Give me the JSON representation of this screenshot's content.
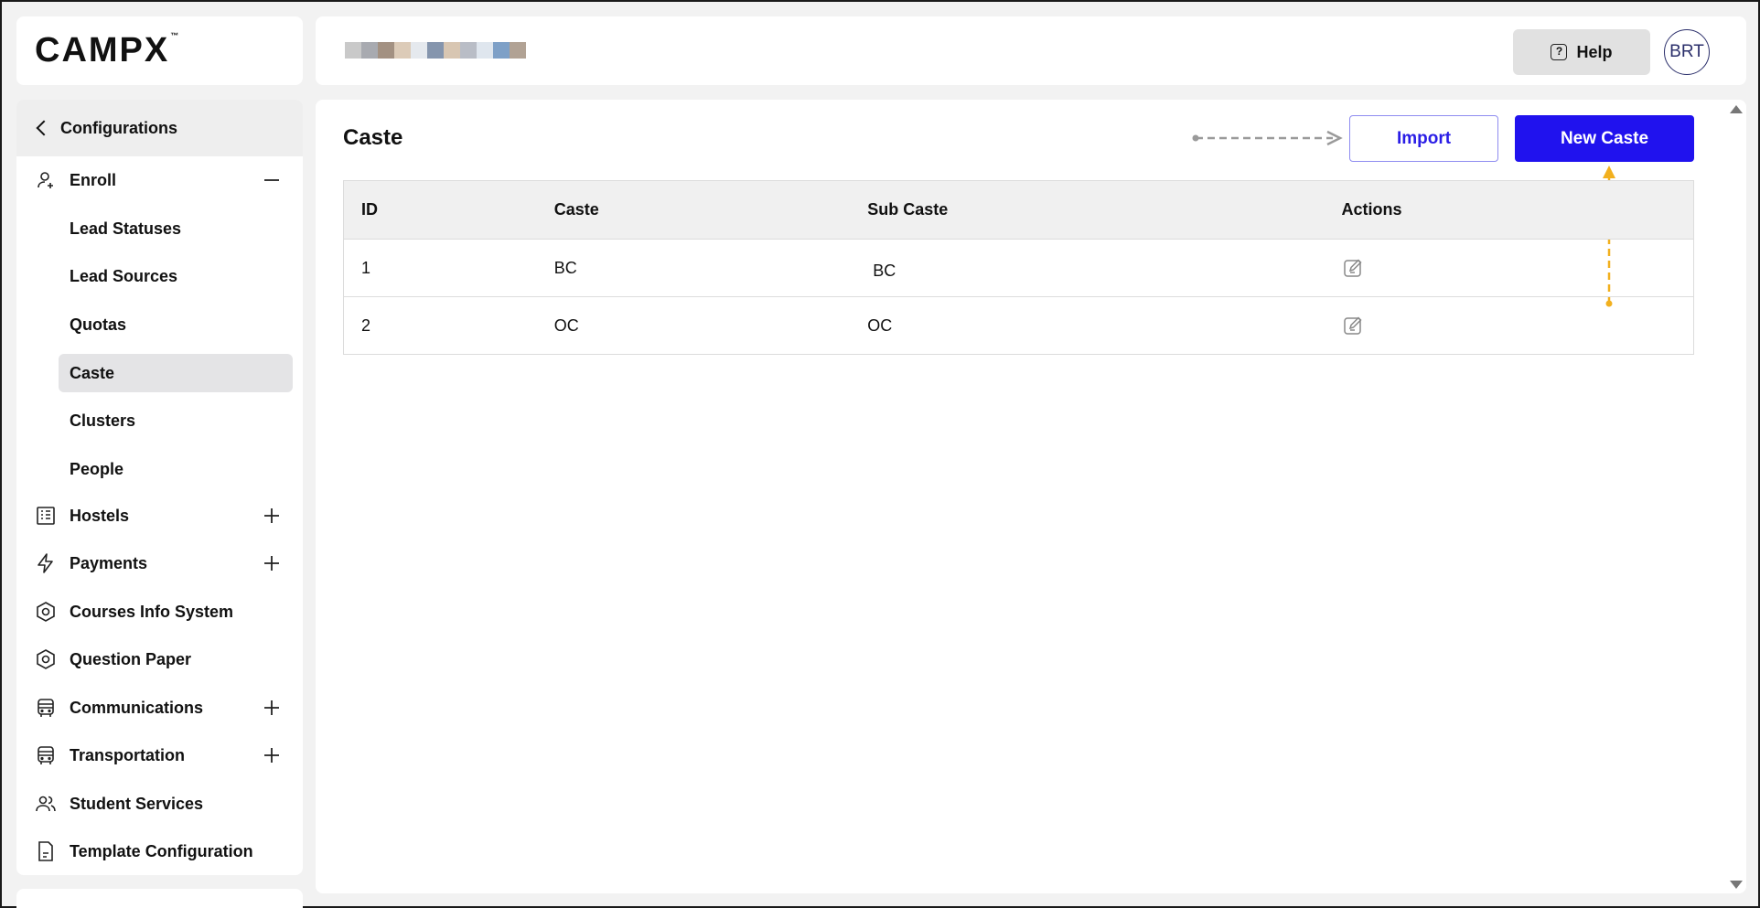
{
  "app": {
    "logo_text": "CAMPX"
  },
  "header": {
    "help_label": "Help",
    "avatar_initials": "BRT"
  },
  "sidebar": {
    "back_label": "Configurations",
    "items": [
      {
        "label": "Enroll",
        "icon": "user-add-icon",
        "toggle": "minus-icon"
      },
      {
        "label": "Hostels",
        "icon": "building-icon",
        "toggle": "plus-icon"
      },
      {
        "label": "Payments",
        "icon": "lightning-icon",
        "toggle": "plus-icon"
      },
      {
        "label": "Courses Info System",
        "icon": "hexagon-gear-icon",
        "toggle": ""
      },
      {
        "label": "Question Paper",
        "icon": "hexagon-gear-icon",
        "toggle": ""
      },
      {
        "label": "Communications",
        "icon": "bus-icon",
        "toggle": "plus-icon"
      },
      {
        "label": "Transportation",
        "icon": "bus-icon",
        "toggle": "plus-icon"
      },
      {
        "label": "Student Services",
        "icon": "users-icon",
        "toggle": ""
      },
      {
        "label": "Template Configuration",
        "icon": "document-icon",
        "toggle": ""
      }
    ],
    "enroll_sub_items": [
      {
        "label": "Lead Statuses"
      },
      {
        "label": "Lead Sources"
      },
      {
        "label": "Quotas"
      },
      {
        "label": "Caste",
        "active": true
      },
      {
        "label": "Clusters"
      },
      {
        "label": "People"
      }
    ]
  },
  "main": {
    "title": "Caste",
    "import_label": "Import",
    "new_label": "New Caste",
    "table": {
      "columns": [
        "ID",
        "Caste",
        "Sub Caste",
        "Actions"
      ],
      "rows": [
        {
          "id": "1",
          "caste": "BC",
          "sub_caste": "BC"
        },
        {
          "id": "2",
          "caste": "OC",
          "sub_caste": "OC"
        }
      ]
    }
  },
  "colors": {
    "primary": "#2012ee",
    "import_text": "#2a1de6",
    "active_bg": "#e4e4e6",
    "annotation_gray": "#9a9a9a",
    "annotation_orange": "#f2b01e"
  }
}
